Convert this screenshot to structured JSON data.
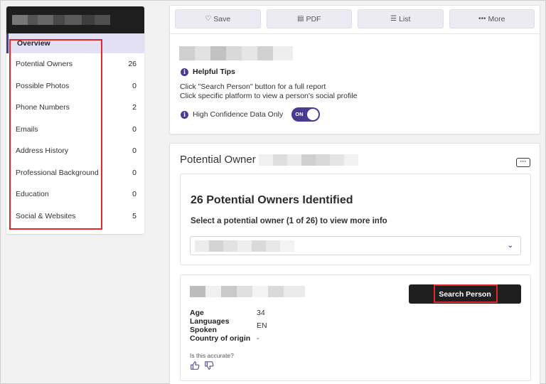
{
  "sidebar": {
    "items": [
      {
        "label": "Overview",
        "count": ""
      },
      {
        "label": "Potential Owners",
        "count": "26"
      },
      {
        "label": "Possible Photos",
        "count": "0"
      },
      {
        "label": "Phone Numbers",
        "count": "2"
      },
      {
        "label": "Emails",
        "count": "0"
      },
      {
        "label": "Address History",
        "count": "0"
      },
      {
        "label": "Professional Background",
        "count": "0"
      },
      {
        "label": "Education",
        "count": "0"
      },
      {
        "label": "Social & Websites",
        "count": "5"
      }
    ]
  },
  "toolbar": {
    "save_label": "Save",
    "pdf_label": "PDF",
    "list_label": "List",
    "more_label": "More"
  },
  "tips": {
    "title": "Helpful Tips",
    "line1": "Click \"Search Person\" button for a full report",
    "line2": "Click specific platform to view a person's social profile",
    "confidence_label": "High Confidence Data Only",
    "toggle_text": "ON"
  },
  "owners_section": {
    "title": "Potential Owner",
    "heading": "26 Potential Owners Identified",
    "select_prompt": "Select a potential owner (1 of 26) to view more info"
  },
  "person": {
    "search_button": "Search Person",
    "details": [
      {
        "label": "Age",
        "value": "34"
      },
      {
        "label": "Languages Spoken",
        "value": "EN"
      },
      {
        "label": "Country of origin",
        "value": "-"
      }
    ],
    "accuracy_question": "Is this accurate?"
  },
  "colors": {
    "accent": "#4a3a92",
    "highlight_box": "#e2262b",
    "header_dark": "#1e1e1e"
  }
}
